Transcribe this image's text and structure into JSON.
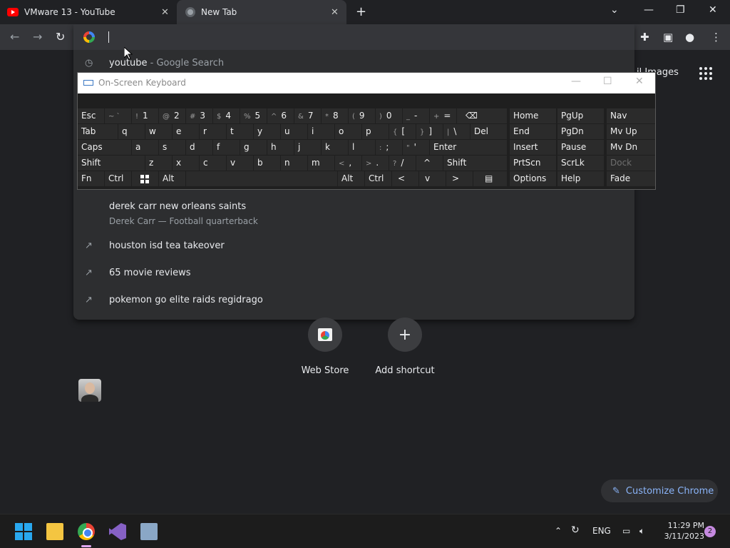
{
  "browser": {
    "tabs": [
      {
        "title": "VMware 13 - YouTube",
        "icon": "youtube-icon"
      },
      {
        "title": "New Tab",
        "icon": "chrome-icon"
      }
    ]
  },
  "omnibox": {
    "value": "",
    "history_suggestion": {
      "query": "youtube",
      "source": "- Google Search"
    },
    "suggestions": [
      {
        "text": "derek carr new orleans saints",
        "subtitle": "Derek Carr — Football quarterback"
      },
      {
        "text": "houston isd tea takeover"
      },
      {
        "text": "65 movie reviews"
      },
      {
        "text": "pokemon go elite raids regidrago"
      }
    ]
  },
  "page": {
    "top_links": "il   Images",
    "shortcuts": [
      {
        "label": "Web Store"
      },
      {
        "label": "Add shortcut"
      }
    ],
    "customize_label": "Customize Chrome"
  },
  "osk": {
    "title": "On-Screen Keyboard",
    "keys": {
      "esc": "Esc",
      "tilde": "~ `",
      "k1": "1",
      "k1s": "!",
      "k2": "2",
      "k2s": "@",
      "k3": "3",
      "k3s": "#",
      "k4": "4",
      "k4s": "$",
      "k5": "5",
      "k5s": "%",
      "k6": "6",
      "k6s": "^",
      "k7": "7",
      "k7s": "&",
      "k8": "8",
      "k8s": "*",
      "k9": "9",
      "k9s": "(",
      "k0": "0",
      "k0s": ")",
      "minus": "-",
      "minuss": "_",
      "equals": "=",
      "equalss": "+",
      "backspace": "⌫",
      "tab": "Tab",
      "q": "q",
      "w": "w",
      "e": "e",
      "r": "r",
      "t": "t",
      "y": "y",
      "u": "u",
      "i": "i",
      "o": "o",
      "p": "p",
      "lbr": "[",
      "lbrs": "{",
      "rbr": "]",
      "rbrs": "}",
      "bsl": "\\",
      "bsls": "|",
      "del": "Del",
      "caps": "Caps",
      "a": "a",
      "s": "s",
      "d": "d",
      "f": "f",
      "g": "g",
      "h": "h",
      "j": "j",
      "k": "k",
      "l": "l",
      "semi": ";",
      "semis": ":",
      "quote": "'",
      "quotes": "\"",
      "enter": "Enter",
      "shift_l": "Shift",
      "z": "z",
      "x": "x",
      "c": "c",
      "v": "v",
      "b": "b",
      "n": "n",
      "m": "m",
      "comma": ",",
      "commas": "<",
      "period": ".",
      "periods": ">",
      "slash": "/",
      "slashs": "?",
      "up": "^",
      "shift_r": "Shift",
      "fn": "Fn",
      "ctrl_l": "Ctrl",
      "alt_l": "Alt",
      "alt_r": "Alt",
      "ctrl_r": "Ctrl",
      "left": "<",
      "down": "v",
      "right": ">",
      "home": "Home",
      "pgup": "PgUp",
      "nav": "Nav",
      "end": "End",
      "pgdn": "PgDn",
      "mvup": "Mv Up",
      "insert": "Insert",
      "pause": "Pause",
      "mvdn": "Mv Dn",
      "prtscn": "PrtScn",
      "scrlk": "ScrLk",
      "dock": "Dock",
      "options": "Options",
      "help": "Help",
      "fade": "Fade"
    }
  },
  "taskbar": {
    "language": "ENG",
    "time": "11:29 PM",
    "date": "3/11/2023",
    "notifications": "2"
  }
}
